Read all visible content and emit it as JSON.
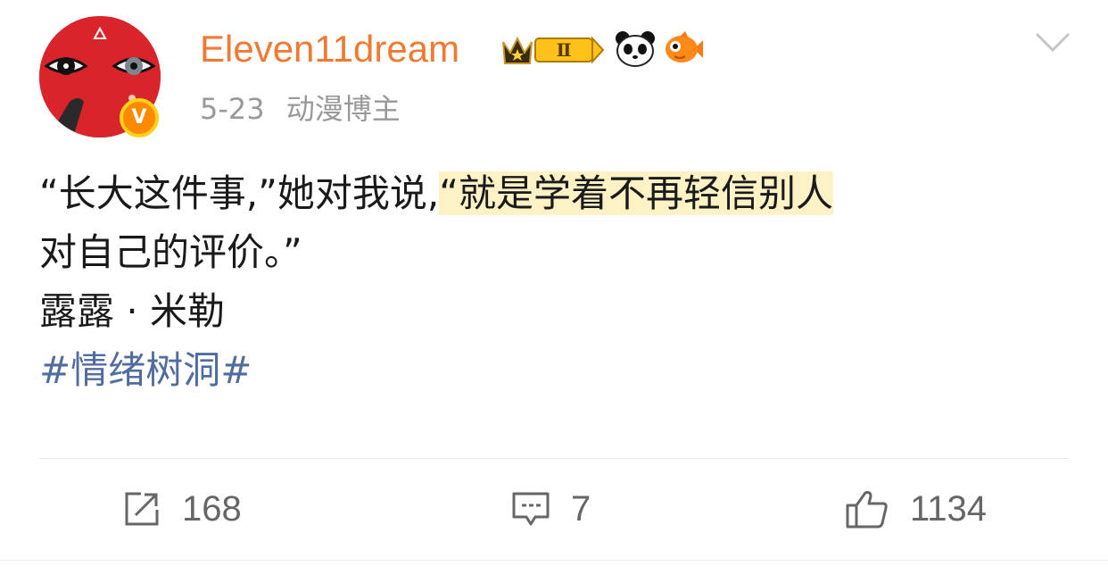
{
  "post": {
    "author": {
      "username": "Eleven11dream",
      "verified_badge": "V",
      "level_badge": "Ⅱ",
      "icons": [
        "crown-icon",
        "level-badge",
        "panda-icon",
        "goldfish-icon"
      ]
    },
    "date": "5-23",
    "tag": "动漫博主",
    "content": {
      "part1": "“长大这件事,”她对我说,",
      "highlight": "“就是学着不再轻信别人",
      "part2": "对自己的评价。”",
      "author_line": "露露 · 米勒",
      "hashtag": "#情绪树洞#"
    }
  },
  "actions": {
    "repost_count": "168",
    "comment_count": "7",
    "like_count": "1134"
  },
  "colors": {
    "username": "#f07a32",
    "hashtag": "#516d9f",
    "highlight": "#fdf1c6",
    "meta": "#999999"
  }
}
